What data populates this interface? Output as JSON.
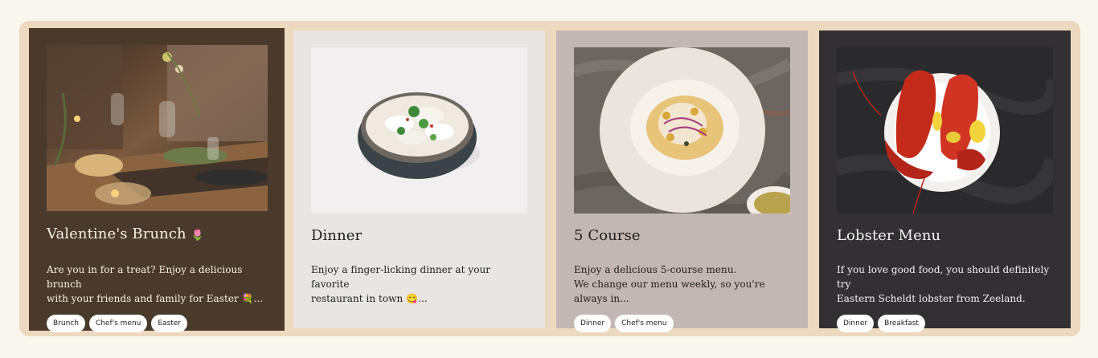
{
  "colors": {
    "page_bg": "#f9f6ee",
    "frame_bg": "#ecd9bf",
    "card1_bg": "#4a3a2c",
    "card2_bg": "#e9e5e2",
    "card3_bg": "#c2b7b2",
    "card4_bg": "#333033"
  },
  "cards": [
    {
      "title": "Valentine's Brunch",
      "title_emoji": "🌷",
      "desc_line1": "Are you in for a treat? Enjoy a delicious brunch",
      "desc_line2": "with your friends and family for Easter 💐...",
      "tags": [
        "Brunch",
        "Chef's menu",
        "Easter"
      ],
      "image_icon": "brunch-table-photo"
    },
    {
      "title": "Dinner",
      "desc_line1": "Enjoy a finger-licking dinner at your favorite",
      "desc_line2": "restaurant in town 😋...",
      "tags": [],
      "image_icon": "dumplings-bowl-photo"
    },
    {
      "title": "5 Course",
      "desc_line1": "Enjoy a delicious 5-course menu.",
      "desc_line2": "We change our menu weekly, so you're always in...",
      "tags": [
        "Dinner",
        "Chef's menu"
      ],
      "image_icon": "ceviche-plate-photo"
    },
    {
      "title": "Lobster Menu",
      "desc_line1": "If you love good food, you should definitely try",
      "desc_line2": "Eastern Scheldt lobster from Zeeland.",
      "tags": [
        "Dinner",
        "Breakfast"
      ],
      "image_icon": "lobster-plate-photo"
    }
  ]
}
